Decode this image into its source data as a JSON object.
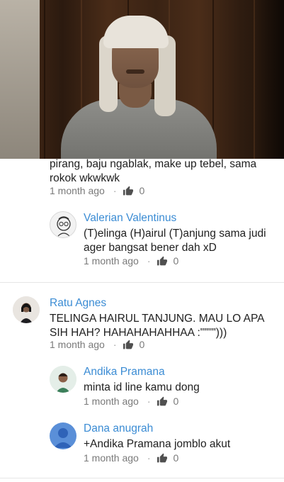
{
  "comments": [
    {
      "text": "pirang, baju ngablak, make up tebel, sama rokok wkwkwk",
      "time": "1 month ago",
      "likes": "0",
      "dot": "·"
    },
    {
      "author": "Valerian Valentinus",
      "text": "(T)elinga (H)airul (T)anjung sama judi ager bangsat bener dah xD",
      "time": "1 month ago",
      "likes": "0",
      "dot": "·"
    },
    {
      "author": "Ratu Agnes",
      "text": "TELINGA HAIRUL TANJUNG. MAU LO APA SIH HAH? HAHAHAHAHHAA :\"\"\"\")))",
      "time": "1 month ago",
      "likes": "0",
      "dot": "·"
    },
    {
      "author": "Andika Pramana",
      "text": "minta id line kamu dong",
      "time": "1 month ago",
      "likes": "0",
      "dot": "·"
    },
    {
      "author": "Dana anugrah",
      "text": "+Andika Pramana jomblo akut",
      "time": "1 month ago",
      "likes": "0",
      "dot": "·"
    }
  ],
  "colors": {
    "author": "#3b8cd4",
    "text": "#202020",
    "meta": "#7a7a7a",
    "default_avatar": "#5a8fd8"
  }
}
